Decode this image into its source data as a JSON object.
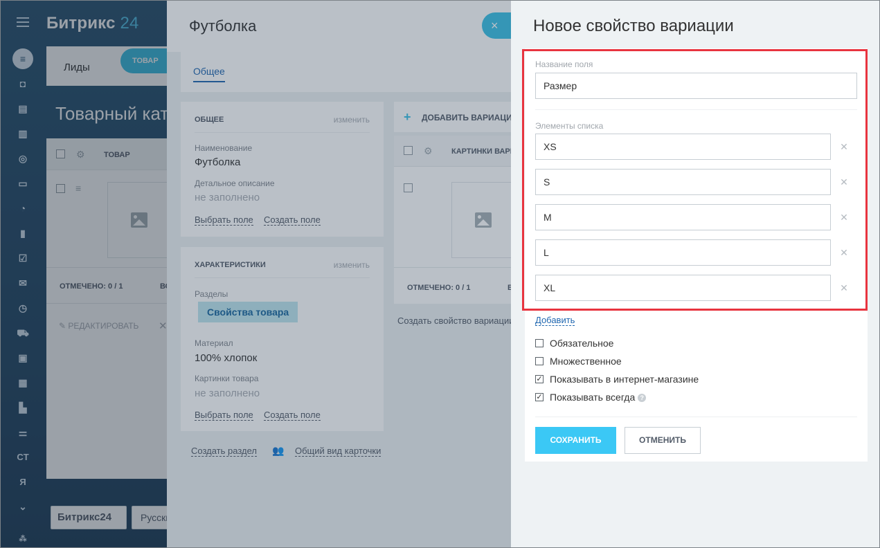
{
  "shell": {
    "brand_name": "Битрикс",
    "brand_num": "24",
    "crm_tab_leads": "Лиды",
    "crm_pill": "ТОВАР",
    "catalog_title": "Товарный каталог",
    "grid_col_product": "ТОВАР",
    "marked": "ОТМЕЧЕНО: 0 / 1",
    "marked_extra": "ВС",
    "edit_action": "РЕДАКТИРОВАТЬ",
    "bottom_logo": "Битрикс24",
    "bottom_lang": "Русский",
    "left_icons": [
      "filter-icon",
      "robot-icon",
      "calendar-icon",
      "book-icon",
      "target-icon",
      "inbox-icon",
      "clock-pie-icon",
      "chart-icon",
      "task-icon",
      "mail-icon",
      "time-icon",
      "cart-icon",
      "window-icon",
      "grid-icon",
      "printer-icon",
      "settings-icon",
      "CT",
      "Я",
      "chevron-down-icon",
      "tree-icon"
    ]
  },
  "product": {
    "title": "Футболка",
    "tab_general": "Общее",
    "close_glyph": "×",
    "card_general": {
      "caption": "ОБЩЕЕ",
      "edit": "изменить",
      "name_label": "Наименование",
      "name_value": "Футболка",
      "desc_label": "Детальное описание",
      "desc_value": "не заполнено",
      "choose_field": "Выбрать поле",
      "create_field": "Создать поле"
    },
    "card_props": {
      "caption": "ХАРАКТЕРИСТИКИ",
      "edit": "изменить",
      "sections_label": "Разделы",
      "sections_tag": "Свойства товара",
      "material_label": "Материал",
      "material_value": "100% хлопок",
      "pictures_label": "Картинки товара",
      "pictures_value": "не заполнено",
      "choose_field": "Выбрать поле",
      "create_field": "Создать поле"
    },
    "create_section": "Создать раздел",
    "common_view": "Общий вид карточки",
    "variations": {
      "add_label": "ДОБАВИТЬ ВАРИАЦИЮ",
      "col_pictures": "КАРТИНКИ ВАРИАЦИИ",
      "marked": "ОТМЕЧЕНО: 0 / 1",
      "marked_extra": "В",
      "create_prop": "Создать свойство вариации"
    }
  },
  "property_form": {
    "title": "Новое свойство вариации",
    "field_name_label": "Название поля",
    "field_name_value": "Размер",
    "list_label": "Элементы списка",
    "items": [
      "XS",
      "S",
      "M",
      "L",
      "XL"
    ],
    "add_link": "Добавить",
    "checkboxes": [
      {
        "label": "Обязательное",
        "checked": false
      },
      {
        "label": "Множественное",
        "checked": false
      },
      {
        "label": "Показывать в интернет-магазине",
        "checked": true
      },
      {
        "label": "Показывать всегда",
        "checked": true
      }
    ],
    "help_glyph": "?",
    "save_label": "СОХРАНИТЬ",
    "cancel_label": "ОТМЕНИТЬ"
  },
  "colors": {
    "accent": "#3bc8f5",
    "link": "#2067b0",
    "highlight": "#e8343f"
  }
}
